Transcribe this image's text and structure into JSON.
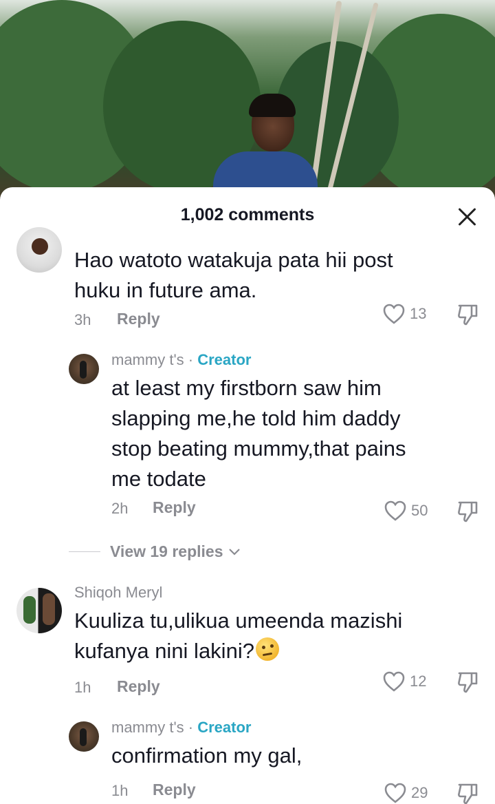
{
  "header": {
    "title": "1,002 comments"
  },
  "comments": [
    {
      "username": "",
      "text_lines": [
        "Hao watoto watakuja pata hii post",
        "huku in future ama."
      ],
      "time": "3h",
      "reply_label": "Reply",
      "likes": "13"
    },
    {
      "username": "mammy t's",
      "separator": " · ",
      "badge": "Creator",
      "text_lines": [
        "at least my firstborn saw him",
        "slapping me,he told him daddy",
        "stop beating mummy,that pains",
        "me todate"
      ],
      "time": "2h",
      "reply_label": "Reply",
      "likes": "50"
    },
    {
      "username": "Shiqoh Meryl",
      "text_lines": [
        "Kuuliza tu,ulikua umeenda mazishi",
        "kufanya nini lakini?"
      ],
      "emoji": "thinking-face",
      "time": "1h",
      "reply_label": "Reply",
      "likes": "12"
    },
    {
      "username": "mammy t's",
      "separator": " · ",
      "badge": "Creator",
      "text_lines": [
        "confirmation my gal,"
      ],
      "time": "1h",
      "reply_label": "Reply",
      "likes": "29"
    }
  ],
  "view_replies": {
    "label": "View 19 replies"
  },
  "icons": {
    "close": "close-icon",
    "like": "heart-outline-icon",
    "dislike": "thumbs-down-icon",
    "chevron": "chevron-down-icon"
  },
  "colors": {
    "creator_badge": "#2aa6c4",
    "secondary_text": "#8a8b91"
  }
}
